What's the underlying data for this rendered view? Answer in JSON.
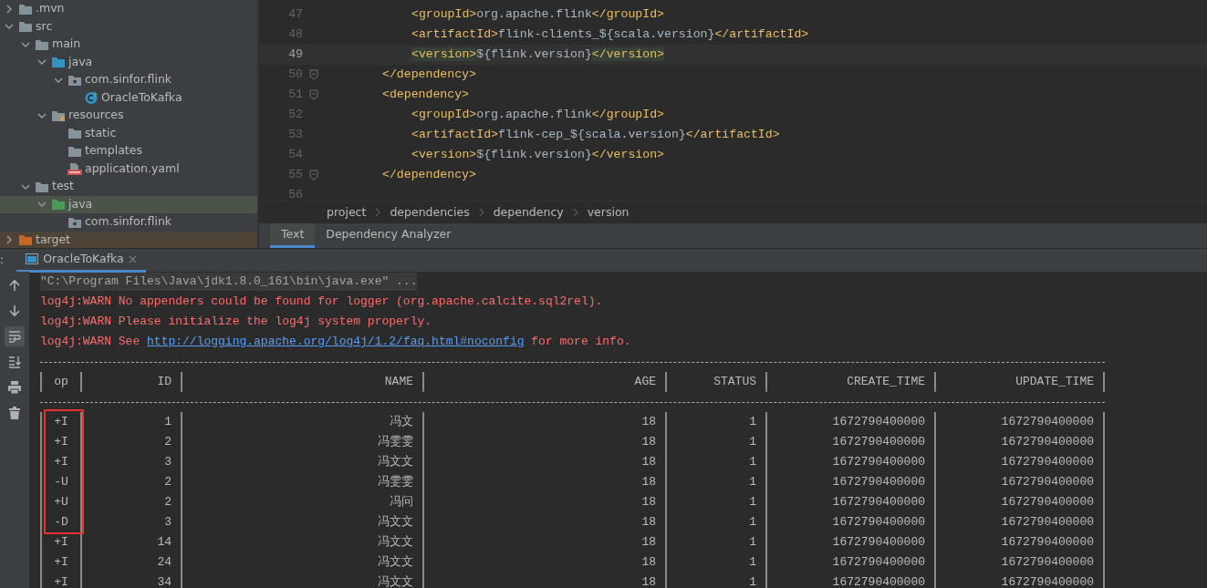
{
  "project_tree": {
    "items": [
      {
        "label": ".mvn",
        "kind": "folder",
        "expanded": false,
        "selected": false
      },
      {
        "label": "src",
        "kind": "folder",
        "expanded": true,
        "selected": false,
        "children": [
          {
            "label": "main",
            "kind": "folder",
            "expanded": true,
            "selected": false,
            "children": [
              {
                "label": "java",
                "kind": "source",
                "expanded": true,
                "selected": false,
                "children": [
                  {
                    "label": "com.sinfor.flink",
                    "kind": "package",
                    "expanded": true,
                    "selected": false,
                    "children": [
                      {
                        "label": "OracleToKafka",
                        "kind": "class",
                        "selected": false
                      }
                    ]
                  }
                ]
              },
              {
                "label": "resources",
                "kind": "resources",
                "expanded": true,
                "selected": false,
                "children": [
                  {
                    "label": "static",
                    "kind": "folder",
                    "selected": false
                  },
                  {
                    "label": "templates",
                    "kind": "folder",
                    "selected": false
                  },
                  {
                    "label": "application.yaml",
                    "kind": "yaml",
                    "selected": false
                  }
                ]
              }
            ]
          },
          {
            "label": "test",
            "kind": "folder",
            "expanded": true,
            "selected": false,
            "children": [
              {
                "label": "java",
                "kind": "test",
                "expanded": true,
                "selected": true,
                "children": [
                  {
                    "label": "com.sinfor.flink",
                    "kind": "package",
                    "selected": false
                  }
                ]
              }
            ]
          }
        ]
      },
      {
        "label": "target",
        "kind": "excluded",
        "expanded": false,
        "selected": false
      }
    ]
  },
  "editor": {
    "lines": [
      {
        "number": "47",
        "kind": "inner",
        "current": false,
        "fold": false,
        "segments": [
          {
            "kind": "tag",
            "text": "<groupId>"
          },
          {
            "kind": "plain",
            "text": "org.apache.flink"
          },
          {
            "kind": "tag",
            "text": "</groupId>"
          }
        ]
      },
      {
        "number": "48",
        "kind": "inner",
        "current": false,
        "fold": false,
        "segments": [
          {
            "kind": "tag",
            "text": "<artifactId>"
          },
          {
            "kind": "plain",
            "text": "flink-clients_${scala.version}"
          },
          {
            "kind": "tag",
            "text": "</artifactId>"
          }
        ]
      },
      {
        "number": "49",
        "kind": "inner",
        "current": true,
        "fold": false,
        "segments": [
          {
            "kind": "match",
            "text": "<version>"
          },
          {
            "kind": "plain",
            "text": "${flink.version}"
          },
          {
            "kind": "match",
            "text": "</version>"
          }
        ]
      },
      {
        "number": "50",
        "kind": "outer",
        "current": false,
        "fold": true,
        "segments": [
          {
            "kind": "tag",
            "text": "</dependency>"
          }
        ]
      },
      {
        "number": "51",
        "kind": "outer",
        "current": false,
        "fold": true,
        "segments": [
          {
            "kind": "tag",
            "text": "<dependency>"
          }
        ]
      },
      {
        "number": "52",
        "kind": "inner",
        "current": false,
        "fold": false,
        "segments": [
          {
            "kind": "tag",
            "text": "<groupId>"
          },
          {
            "kind": "plain",
            "text": "org.apache.flink"
          },
          {
            "kind": "tag",
            "text": "</groupId>"
          }
        ]
      },
      {
        "number": "53",
        "kind": "inner",
        "current": false,
        "fold": false,
        "segments": [
          {
            "kind": "tag",
            "text": "<artifactId>"
          },
          {
            "kind": "plain",
            "text": "flink-cep_${scala.version}"
          },
          {
            "kind": "tag",
            "text": "</artifactId>"
          }
        ]
      },
      {
        "number": "54",
        "kind": "inner",
        "current": false,
        "fold": false,
        "segments": [
          {
            "kind": "tag",
            "text": "<version>"
          },
          {
            "kind": "plain",
            "text": "${flink.version}"
          },
          {
            "kind": "tag",
            "text": "</version>"
          }
        ]
      },
      {
        "number": "55",
        "kind": "outer",
        "current": false,
        "fold": true,
        "segments": [
          {
            "kind": "tag",
            "text": "</dependency>"
          }
        ]
      },
      {
        "number": "56",
        "current": false,
        "fold": false
      }
    ]
  },
  "breadcrumbs": [
    "project",
    "dependencies",
    "dependency",
    "version"
  ],
  "editor_tabs": [
    {
      "label": "Text",
      "selected": true
    },
    {
      "label": "Dependency Analyzer",
      "selected": false
    }
  ],
  "run_panel": {
    "label": ":",
    "tabs": [
      {
        "label": "OracleToKafka",
        "selected": true
      }
    ],
    "toolbar": [
      {
        "kind": "up",
        "selected": false
      },
      {
        "kind": "down",
        "selected": false
      },
      {
        "kind": "wrap",
        "selected": true
      },
      {
        "kind": "scroll-end",
        "selected": false
      },
      {
        "kind": "print",
        "selected": false
      },
      {
        "kind": "trash",
        "selected": false
      }
    ],
    "console": [
      {
        "kind": "command",
        "segments": [
          {
            "kind": "plain",
            "text": "\"C:\\Program Files\\Java\\jdk1.8.0_161\\bin\\java.exe\" ..."
          }
        ]
      },
      {
        "kind": "error",
        "segments": [
          {
            "kind": "plain",
            "text": "log4j:WARN No appenders could be found for logger (org.apache.calcite.sql2rel)."
          }
        ]
      },
      {
        "kind": "error",
        "segments": [
          {
            "kind": "plain",
            "text": "log4j:WARN Please initialize the log4j system properly."
          }
        ]
      },
      {
        "kind": "error",
        "segments": [
          {
            "kind": "plain",
            "text": "log4j:WARN See "
          },
          {
            "kind": "link",
            "text": "http://logging.apache.org/log4j/1.2/faq.html#noconfig"
          },
          {
            "kind": "plain",
            "text": " for more info."
          }
        ]
      }
    ],
    "table": {
      "columns": [
        "op",
        "ID",
        "NAME",
        "AGE",
        "STATUS",
        "CREATE_TIME",
        "UPDATE_TIME"
      ],
      "rows": [
        {
          "highlighted": true,
          "cells": [
            "+I",
            "1",
            "冯文",
            "18",
            "1",
            "1672790400000",
            "1672790400000"
          ]
        },
        {
          "highlighted": true,
          "cells": [
            "+I",
            "2",
            "冯雯雯",
            "18",
            "1",
            "1672790400000",
            "1672790400000"
          ]
        },
        {
          "highlighted": true,
          "cells": [
            "+I",
            "3",
            "冯文文",
            "18",
            "1",
            "1672790400000",
            "1672790400000"
          ]
        },
        {
          "highlighted": true,
          "cells": [
            "-U",
            "2",
            "冯雯雯",
            "18",
            "1",
            "1672790400000",
            "1672790400000"
          ]
        },
        {
          "highlighted": true,
          "cells": [
            "+U",
            "2",
            "冯问",
            "18",
            "1",
            "1672790400000",
            "1672790400000"
          ]
        },
        {
          "highlighted": true,
          "cells": [
            "-D",
            "3",
            "冯文文",
            "18",
            "1",
            "1672790400000",
            "1672790400000"
          ]
        },
        {
          "highlighted": false,
          "cells": [
            "+I",
            "14",
            "冯文文",
            "18",
            "1",
            "1672790400000",
            "1672790400000"
          ]
        },
        {
          "highlighted": false,
          "cells": [
            "+I",
            "24",
            "冯文文",
            "18",
            "1",
            "1672790400000",
            "1672790400000"
          ]
        },
        {
          "highlighted": false,
          "cells": [
            "+I",
            "34",
            "冯文文",
            "18",
            "1",
            "1672790400000",
            "1672790400000"
          ]
        }
      ]
    }
  }
}
